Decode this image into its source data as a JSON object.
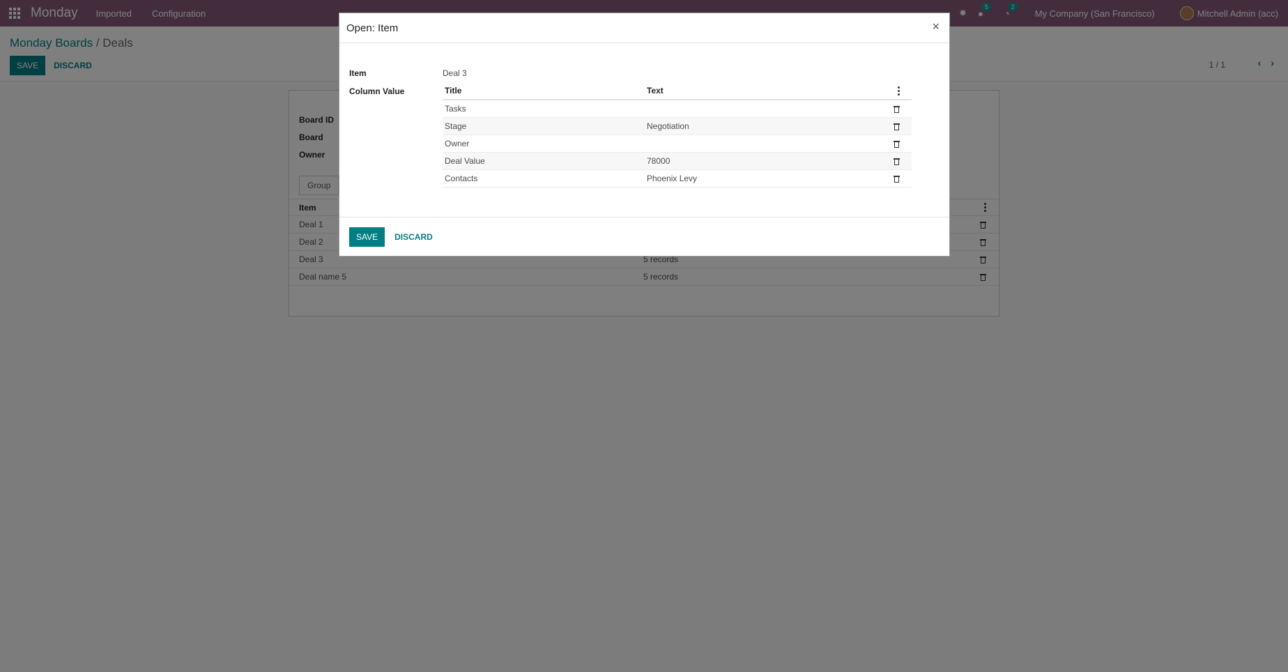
{
  "navbar": {
    "brand": "Monday",
    "menu": [
      "Imported",
      "Configuration"
    ],
    "messages_count": "5",
    "activity_count": "2",
    "company": "My Company (San Francisco)",
    "user": "Mitchell Admin (acc)"
  },
  "control_panel": {
    "breadcrumb_parent": "Monday Boards",
    "breadcrumb_sep": "/",
    "breadcrumb_current": "Deals",
    "save_label": "SAVE",
    "discard_label": "DISCARD",
    "pager": "1 / 1"
  },
  "background_form": {
    "labels": [
      "Board ID",
      "Board",
      "Owner"
    ],
    "tab_label": "Group",
    "table_header": "Item",
    "rows": [
      {
        "item": "Deal 1",
        "records": ""
      },
      {
        "item": "Deal 2",
        "records": ""
      },
      {
        "item": "Deal 3",
        "records": "5 records"
      },
      {
        "item": "Deal name 5",
        "records": "5 records"
      }
    ]
  },
  "modal": {
    "title": "Open: Item",
    "close_symbol": "×",
    "item_label": "Item",
    "item_value": "Deal 3",
    "column_value_label": "Column Value",
    "table": {
      "headers": [
        "Title",
        "Text"
      ],
      "rows": [
        {
          "title": "Tasks",
          "text": ""
        },
        {
          "title": "Stage",
          "text": "Negotiation"
        },
        {
          "title": "Owner",
          "text": ""
        },
        {
          "title": "Deal Value",
          "text": "78000"
        },
        {
          "title": "Contacts",
          "text": "Phoenix Levy"
        }
      ]
    },
    "save_label": "SAVE",
    "discard_label": "DISCARD"
  },
  "colors": {
    "navbar": "#875a7b",
    "primary": "#017e84",
    "badge": "#00a09d"
  }
}
